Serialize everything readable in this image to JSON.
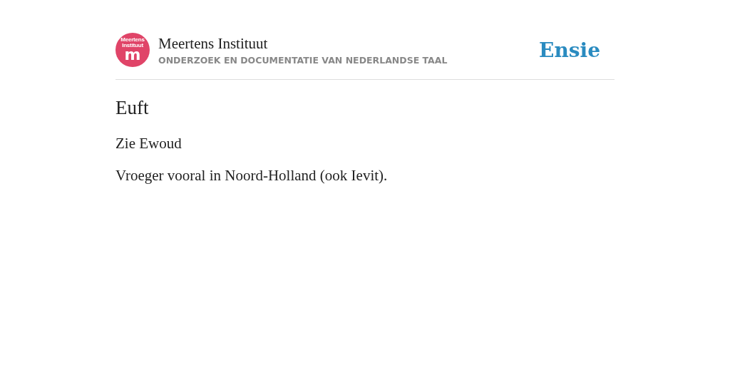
{
  "header": {
    "logo": {
      "line_1": "Meertens",
      "line_2": "Instituut",
      "letter": "m"
    },
    "title": "Meertens Instituut",
    "subtitle": "ONDERZOEK EN DOCUMENTATIE VAN NEDERLANDSE TAAL",
    "brand": "Ensie"
  },
  "entry": {
    "heading": "Euft",
    "paragraphs": [
      "Zie Ewoud",
      "Vroeger vooral in Noord-Holland (ook Ievit)."
    ]
  }
}
